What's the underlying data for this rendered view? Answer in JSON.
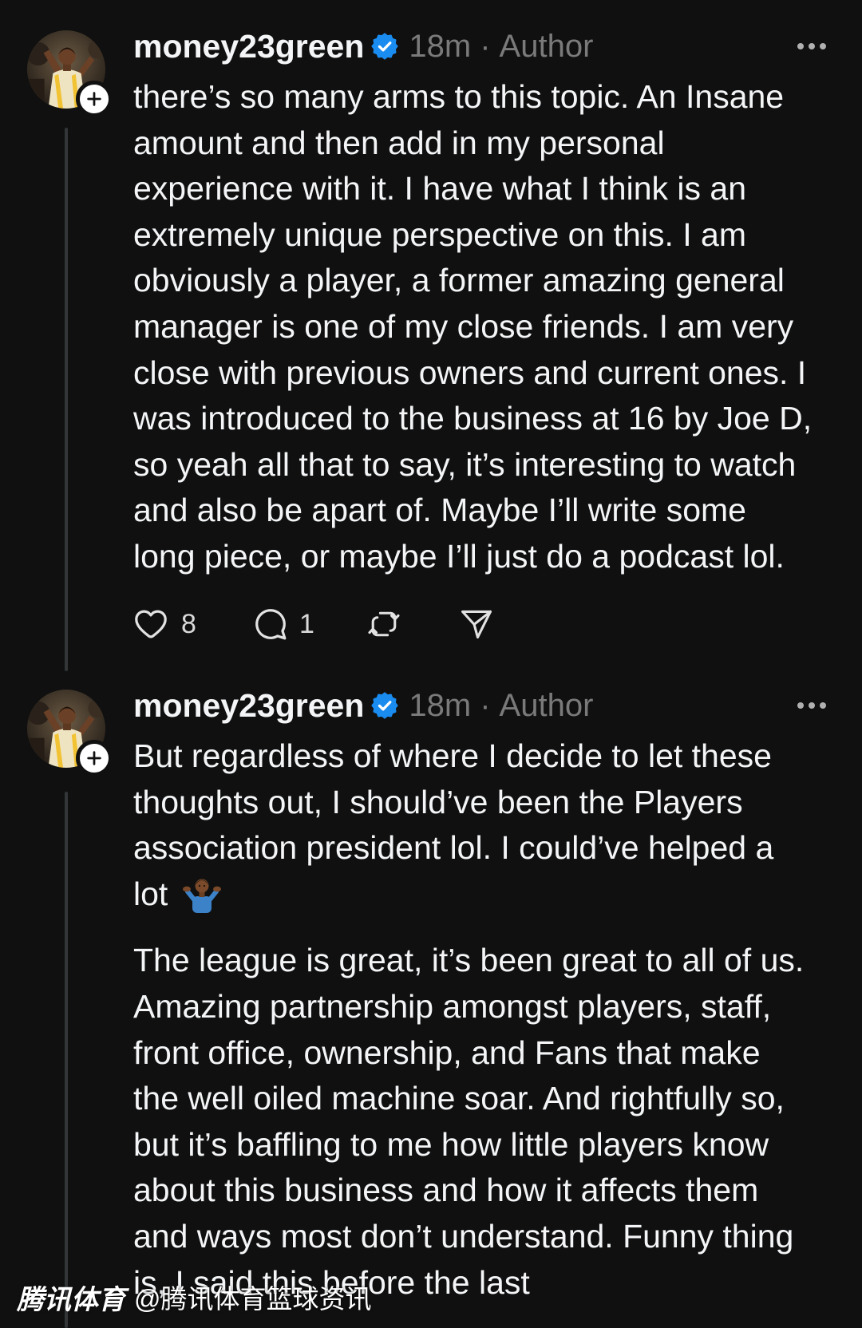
{
  "colors": {
    "background": "#101010",
    "text": "#f3f5f7",
    "secondary_text": "#7a7a7a",
    "verified_blue": "#1a8cf0",
    "thread_line": "#333638",
    "action_icons": "#e2e2e2"
  },
  "posts": [
    {
      "avatar_icon": "profile-photo",
      "follow_icon": "plus-icon",
      "username": "money23green",
      "verified_icon": "verified-badge-icon",
      "time": "18m",
      "separator": "·",
      "role_label": "Author",
      "more_icon": "more-horizontal-icon",
      "paragraphs": [
        [
          "there’s so many arms to this topic. An Insane",
          "amount and then add in my personal",
          "experience with it. I have what I think is an",
          "extremely unique perspective on this. I am",
          "obviously a player, a former amazing general",
          "manager is one of my close friends. I am very",
          "close with previous owners and current ones. I",
          "was introduced to the business at 16 by Joe D,",
          "so yeah all that to say, it’s interesting to watch",
          "and also be apart of. Maybe I’ll write some",
          "long piece, or maybe I’ll just do a podcast lol."
        ]
      ],
      "actions": {
        "like_icon": "heart-icon",
        "like_count": "8",
        "reply_icon": "comment-icon",
        "reply_count": "1",
        "repost_icon": "repost-icon",
        "share_icon": "share-icon"
      }
    },
    {
      "avatar_icon": "profile-photo",
      "follow_icon": "plus-icon",
      "username": "money23green",
      "verified_icon": "verified-badge-icon",
      "time": "18m",
      "separator": "·",
      "role_label": "Author",
      "more_icon": "more-horizontal-icon",
      "inline_emoji_icon": "shrug-emoji-icon",
      "paragraphs": [
        [
          "But regardless of where I decide to let these",
          "thoughts out, I should’ve been the Players",
          "association president lol. I could’ve helped a",
          "lot"
        ],
        [
          "The league is great, it’s been great to all of us.",
          "Amazing partnership amongst players, staff,",
          "front office, ownership, and Fans that make",
          "the well oiled machine soar. And rightfully so,",
          "but it’s baffling to me how little players know",
          "about this business and how it affects them",
          "and ways most don’t understand. Funny thing",
          "is, I said this before the last"
        ]
      ]
    }
  ],
  "watermark": {
    "brand": "腾讯体育",
    "handle": "@腾讯体育篮球资讯"
  }
}
